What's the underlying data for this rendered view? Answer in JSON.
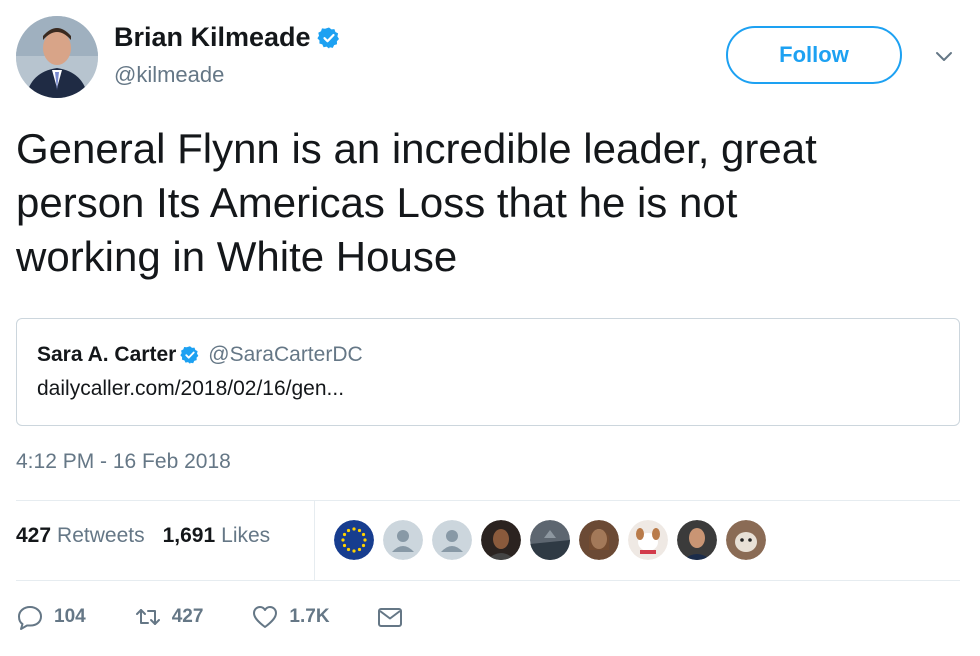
{
  "author": {
    "name": "Brian Kilmeade",
    "handle": "@kilmeade",
    "verified": true
  },
  "follow_button": {
    "label": "Follow"
  },
  "tweet": {
    "lines": [
      "General Flynn is an incredible leader, great",
      "person Its Americas Loss that he is not",
      "working in White House"
    ]
  },
  "quoted_tweet": {
    "name": "Sara A. Carter",
    "handle": "@SaraCarterDC",
    "verified": true,
    "link_text": "dailycaller.com/2018/02/16/gen..."
  },
  "timestamp": "4:12 PM - 16 Feb 2018",
  "stats": {
    "retweets_count": "427",
    "retweets_label": "Retweets",
    "likes_count": "1,691",
    "likes_label": "Likes"
  },
  "liker_avatars": [
    "eu-flag-avatar",
    "default-avatar",
    "default-avatar",
    "person-avatar",
    "landscape-avatar",
    "person-avatar",
    "dog-avatar",
    "person-avatar",
    "dog-avatar"
  ],
  "actions": {
    "reply_count": "104",
    "retweet_count": "427",
    "like_count": "1.7K"
  },
  "colors": {
    "accent": "#1da1f2",
    "text": "#14171a",
    "secondary": "#657786",
    "border": "#ccd6dd"
  }
}
